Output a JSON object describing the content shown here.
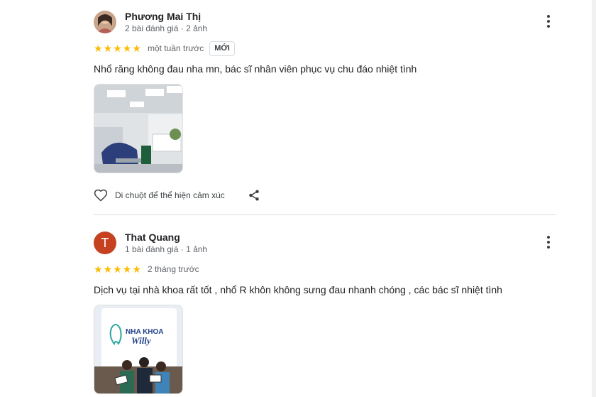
{
  "reviews": [
    {
      "name": "Phương Mai Thị",
      "meta": "2 bài đánh giá · 2 ảnh",
      "stars": 5,
      "when": "một tuần trước",
      "badge": "MỚI",
      "text": "Nhổ răng không đau nha mn, bác sĩ nhân viên phục vụ chu đáo nhiệt tình",
      "react_label": "Di chuột để thể hiện cảm xúc"
    },
    {
      "name": "That Quang",
      "avatar_letter": "T",
      "meta": "1 bài đánh giá · 1 ảnh",
      "stars": 5,
      "when": "2 tháng trước",
      "text": "Dịch vụ tại nhà khoa rất tốt , nhổ R khôn không sưng đau nhanh chóng , các bác sĩ nhiệt tình",
      "photo_sign_line1": "NHA KHOA",
      "photo_sign_line2": "Willy"
    }
  ],
  "colors": {
    "star": "#fbbc04",
    "avatar_t": "#c5411f"
  }
}
